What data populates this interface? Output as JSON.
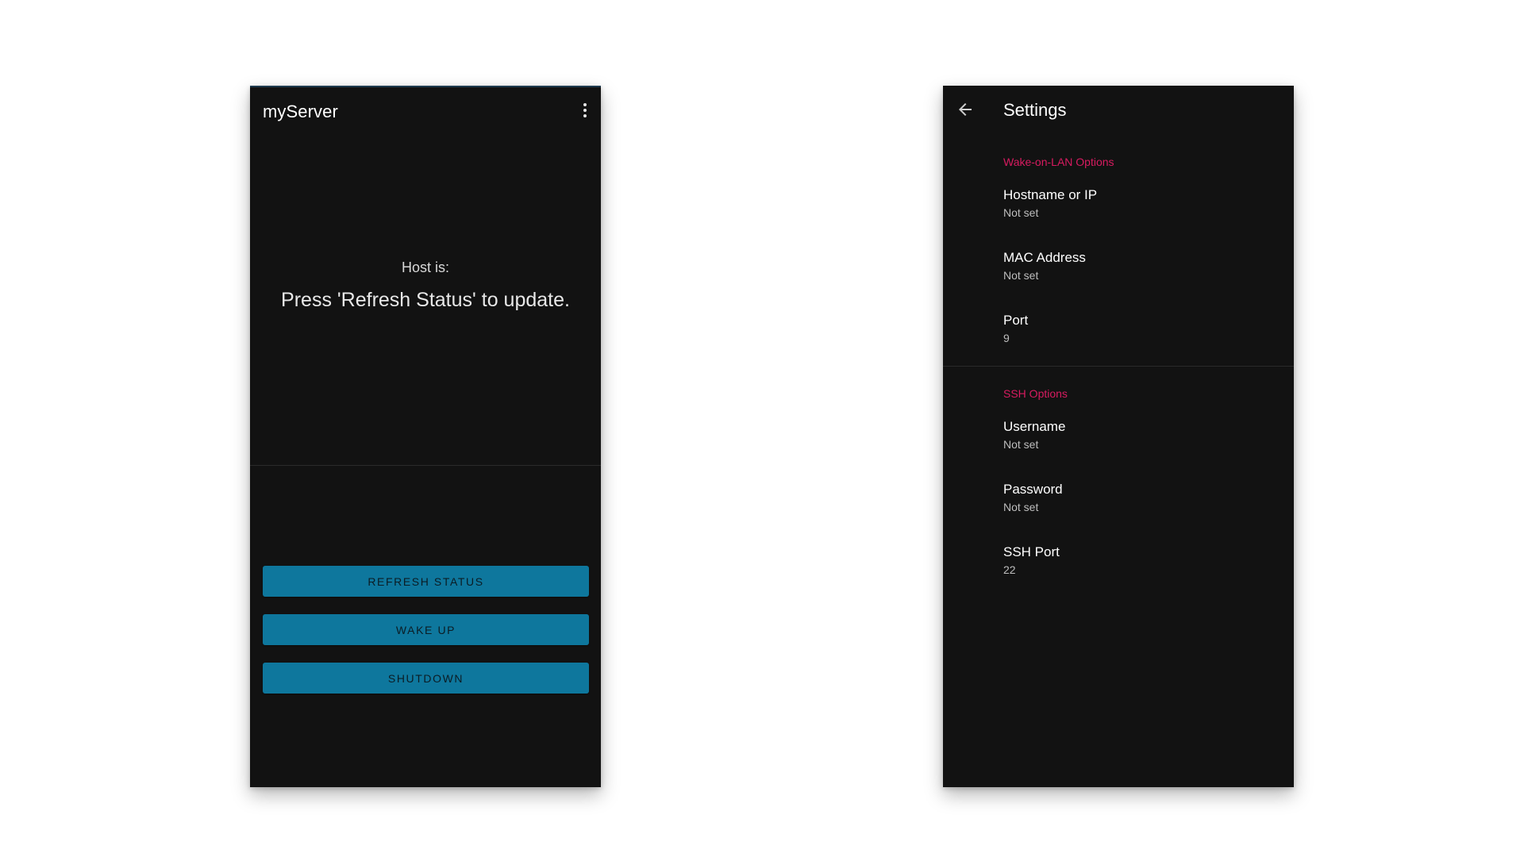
{
  "main_screen": {
    "app_title": "myServer",
    "overflow_menu_icon": "more-vert-icon",
    "status_label": "Host is:",
    "status_value": "Press 'Refresh Status' to update.",
    "buttons": {
      "refresh": "REFRESH STATUS",
      "wake": "WAKE UP",
      "shutdown": "SHUTDOWN"
    }
  },
  "settings_screen": {
    "title": "Settings",
    "back_icon": "arrow-back-icon",
    "sections": [
      {
        "header": "Wake-on-LAN Options",
        "items": [
          {
            "title": "Hostname or IP",
            "summary": "Not set"
          },
          {
            "title": "MAC Address",
            "summary": "Not set"
          },
          {
            "title": "Port",
            "summary": "9"
          }
        ]
      },
      {
        "header": "SSH Options",
        "items": [
          {
            "title": "Username",
            "summary": "Not set"
          },
          {
            "title": "Password",
            "summary": "Not set"
          },
          {
            "title": "SSH Port",
            "summary": "22"
          }
        ]
      }
    ]
  },
  "colors": {
    "background": "#121212",
    "button": "#0e779d",
    "section_header": "#d81b60"
  }
}
